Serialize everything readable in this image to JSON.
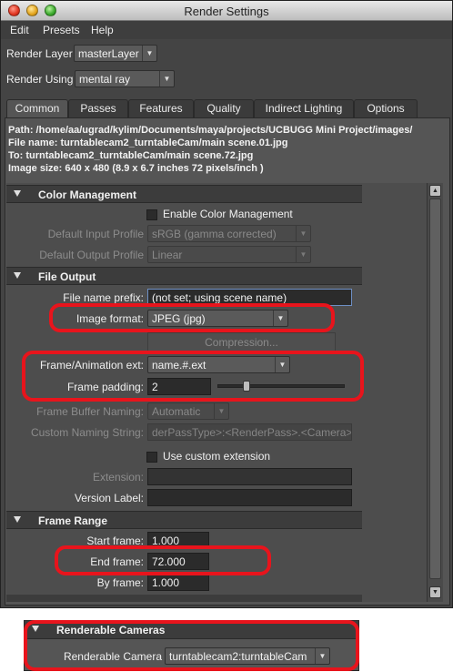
{
  "window": {
    "title": "Render Settings"
  },
  "menu": [
    "Edit",
    "Presets",
    "Help"
  ],
  "render_layer": {
    "label": "Render Layer",
    "value": "masterLayer"
  },
  "render_using": {
    "label": "Render Using",
    "value": "mental ray"
  },
  "tabs": [
    "Common",
    "Passes",
    "Features",
    "Quality",
    "Indirect Lighting",
    "Options"
  ],
  "active_tab": "Common",
  "path_info": [
    "Path: /home/aa/ugrad/kylim/Documents/maya/projects/UCBUGG Mini Project/images/",
    "File name:  turntablecam2_turntableCam/main scene.01.jpg",
    "To:           turntablecam2_turntableCam/main scene.72.jpg",
    "Image size: 640 x 480 (8.9 x 6.7 inches 72 pixels/inch )"
  ],
  "color_management": {
    "header": "Color Management",
    "enable_label": "Enable Color Management",
    "input_profile_label": "Default Input Profile",
    "input_profile_value": "sRGB (gamma corrected)",
    "output_profile_label": "Default Output Profile",
    "output_profile_value": "Linear"
  },
  "file_output": {
    "header": "File Output",
    "prefix_label": "File name prefix:",
    "prefix_value": "(not set; using scene name)",
    "format_label": "Image format:",
    "format_value": "JPEG (jpg)",
    "compression_label": "Compression...",
    "frame_ext_label": "Frame/Animation ext:",
    "frame_ext_value": "name.#.ext",
    "padding_label": "Frame padding:",
    "padding_value": "2",
    "buffer_naming_label": "Frame Buffer Naming:",
    "buffer_naming_value": "Automatic",
    "custom_naming_label": "Custom Naming String:",
    "custom_naming_value": "derPassType>:<RenderPass>.<Camera>",
    "custom_ext_label": "Use custom extension",
    "extension_label": "Extension:",
    "version_label": "Version Label:"
  },
  "frame_range": {
    "header": "Frame Range",
    "start_label": "Start frame:",
    "start_value": "1.000",
    "end_label": "End frame:",
    "end_value": "72.000",
    "by_label": "By frame:",
    "by_value": "1.000"
  },
  "renderable_cameras": {
    "header": "Renderable Cameras",
    "camera_label": "Renderable Camera",
    "camera_value": "turntablecam2:turntableCam"
  },
  "colors": {
    "highlight": "#e8141c",
    "panel": "#555555",
    "section": "#3c3c3c"
  }
}
